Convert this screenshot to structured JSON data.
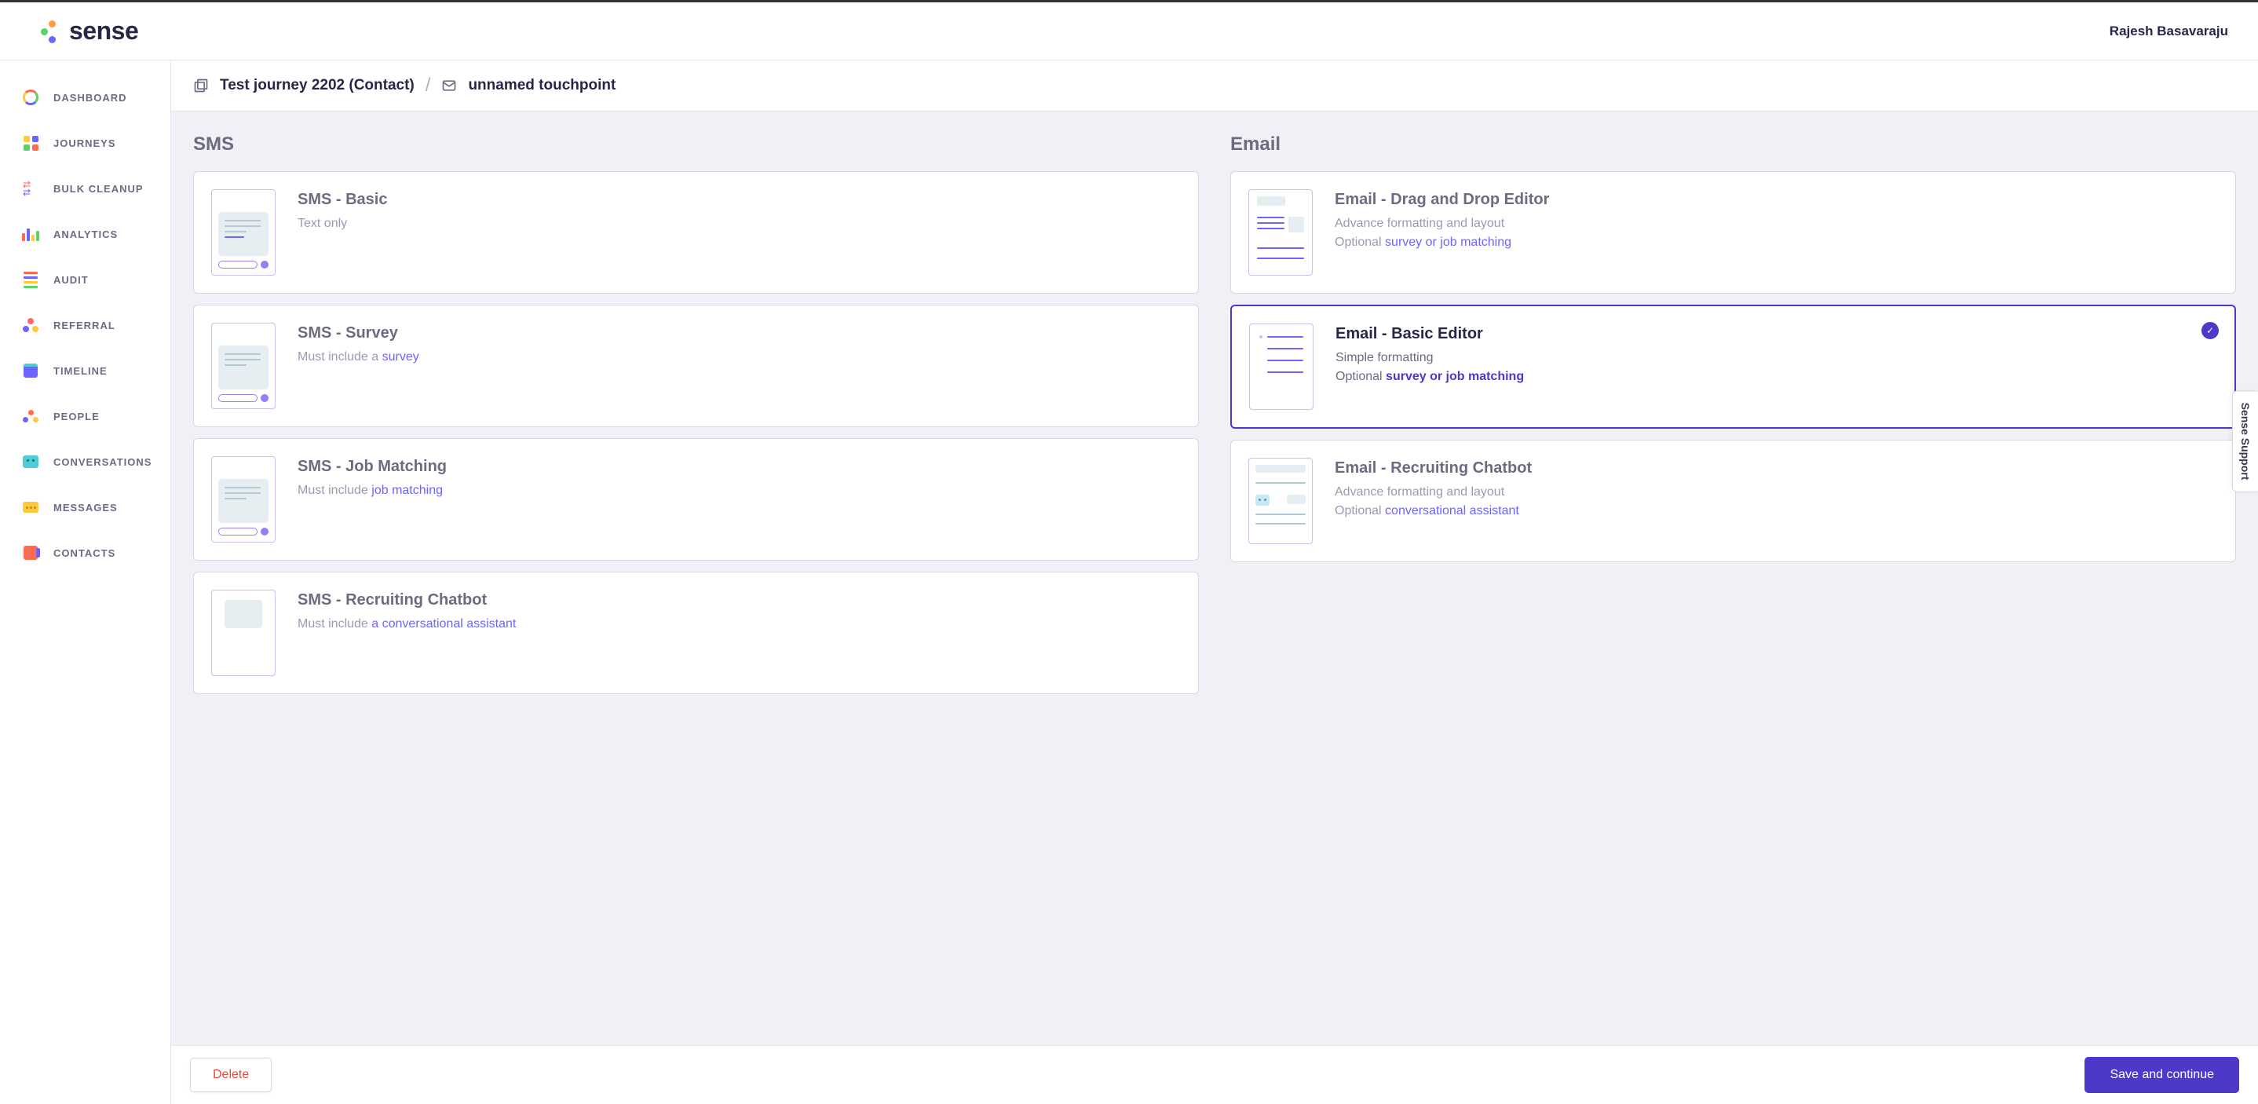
{
  "header": {
    "brand": "sense",
    "user": "Rajesh Basavaraju"
  },
  "nav": {
    "items": [
      {
        "label": "DASHBOARD"
      },
      {
        "label": "JOURNEYS"
      },
      {
        "label": "BULK CLEANUP"
      },
      {
        "label": "ANALYTICS"
      },
      {
        "label": "AUDIT"
      },
      {
        "label": "REFERRAL"
      },
      {
        "label": "TIMELINE"
      },
      {
        "label": "PEOPLE"
      },
      {
        "label": "CONVERSATIONS"
      },
      {
        "label": "MESSAGES"
      },
      {
        "label": "CONTACTS"
      }
    ]
  },
  "breadcrumb": {
    "journey": "Test journey 2202 (Contact)",
    "touchpoint": "unnamed touchpoint"
  },
  "columns": {
    "sms": {
      "title": "SMS",
      "cards": [
        {
          "title": "SMS - Basic",
          "line1": "Text only"
        },
        {
          "title": "SMS - Survey",
          "line1_prefix": "Must include a ",
          "line1_link": "survey"
        },
        {
          "title": "SMS - Job Matching",
          "line1_prefix": "Must include ",
          "line1_link": "job matching"
        },
        {
          "title": "SMS - Recruiting Chatbot",
          "line1_prefix": "Must include ",
          "line1_link": "a conversational assistant"
        }
      ]
    },
    "email": {
      "title": "Email",
      "cards": [
        {
          "title": "Email - Drag and Drop Editor",
          "line1": "Advance formatting and layout",
          "line2_prefix": "Optional ",
          "line2_link": "survey or job matching"
        },
        {
          "title": "Email - Basic Editor",
          "line1": "Simple formatting",
          "line2_prefix": "Optional ",
          "line2_link": "survey or job matching",
          "selected": true
        },
        {
          "title": "Email - Recruiting Chatbot",
          "line1": "Advance formatting and layout",
          "line2_prefix": "Optional ",
          "line2_link": "conversational assistant"
        }
      ]
    }
  },
  "footer": {
    "delete": "Delete",
    "save": "Save and continue"
  },
  "support_tab": "Sense Support"
}
